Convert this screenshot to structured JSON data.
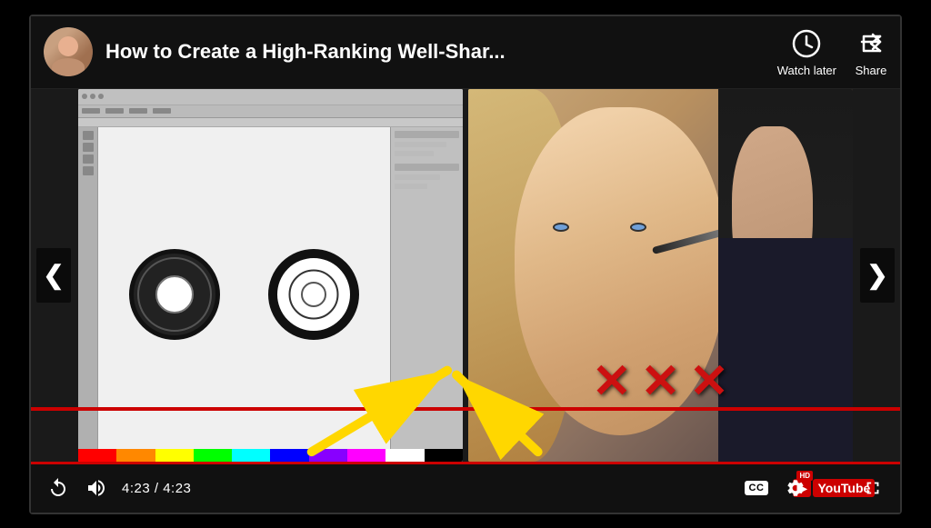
{
  "player": {
    "title": "How to Create a High-Ranking Well-Shar...",
    "watch_later_label": "Watch later",
    "share_label": "Share",
    "time_current": "4:23",
    "time_total": "4:23",
    "time_display": "4:23 / 4:23",
    "progress_percent": 100
  },
  "controls": {
    "replay_icon": "↺",
    "volume_icon": "🔊",
    "cc_label": "CC",
    "hd_label": "HD",
    "youtube_label": "YouTube",
    "fullscreen_icon": "⛶",
    "left_arrow": "❮",
    "right_arrow": "❯"
  },
  "thumbnails": {
    "left_alt": "Design software with school seal",
    "right_alt": "Makeup tutorial video"
  }
}
